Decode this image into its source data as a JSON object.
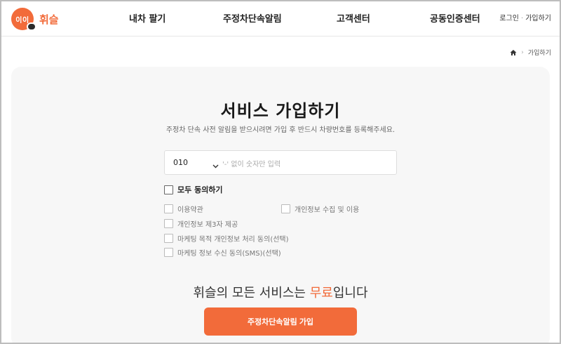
{
  "brand": {
    "mark_text": "이이",
    "name": "휘슬",
    "accent_color": "#f26b3a"
  },
  "nav": {
    "items": [
      {
        "label": "내차 팔기"
      },
      {
        "label": "주정차단속알림"
      },
      {
        "label": "고객센터"
      },
      {
        "label": "공동인증센터"
      }
    ],
    "login": "로그인",
    "signup": "가입하기"
  },
  "breadcrumb": {
    "home_icon": "home-icon",
    "current": "가입하기"
  },
  "signup": {
    "title": "서비스 가입하기",
    "subtitle": "주정차 단속 사전 알림을 받으시려면 가입 후 반드시 차량번호를 등록해주세요.",
    "phone": {
      "prefix": "010",
      "placeholder": "'-' 없이 숫자만 입력"
    },
    "agree_all": "모두 동의하기",
    "terms": [
      {
        "label": "이용약관"
      },
      {
        "label": "개인정보 수집 및 이용"
      },
      {
        "label": "개인정보 제3자 제공"
      },
      {
        "label": "마케팅 목적 개인정보 처리 동의(선택)"
      },
      {
        "label": "마케팅 정보 수신 동의(SMS)(선택)"
      }
    ],
    "free_prefix": "휘슬의 모든 서비스는 ",
    "free_accent": "무료",
    "free_suffix": "입니다",
    "cta": "주정차단속알림 가입"
  }
}
